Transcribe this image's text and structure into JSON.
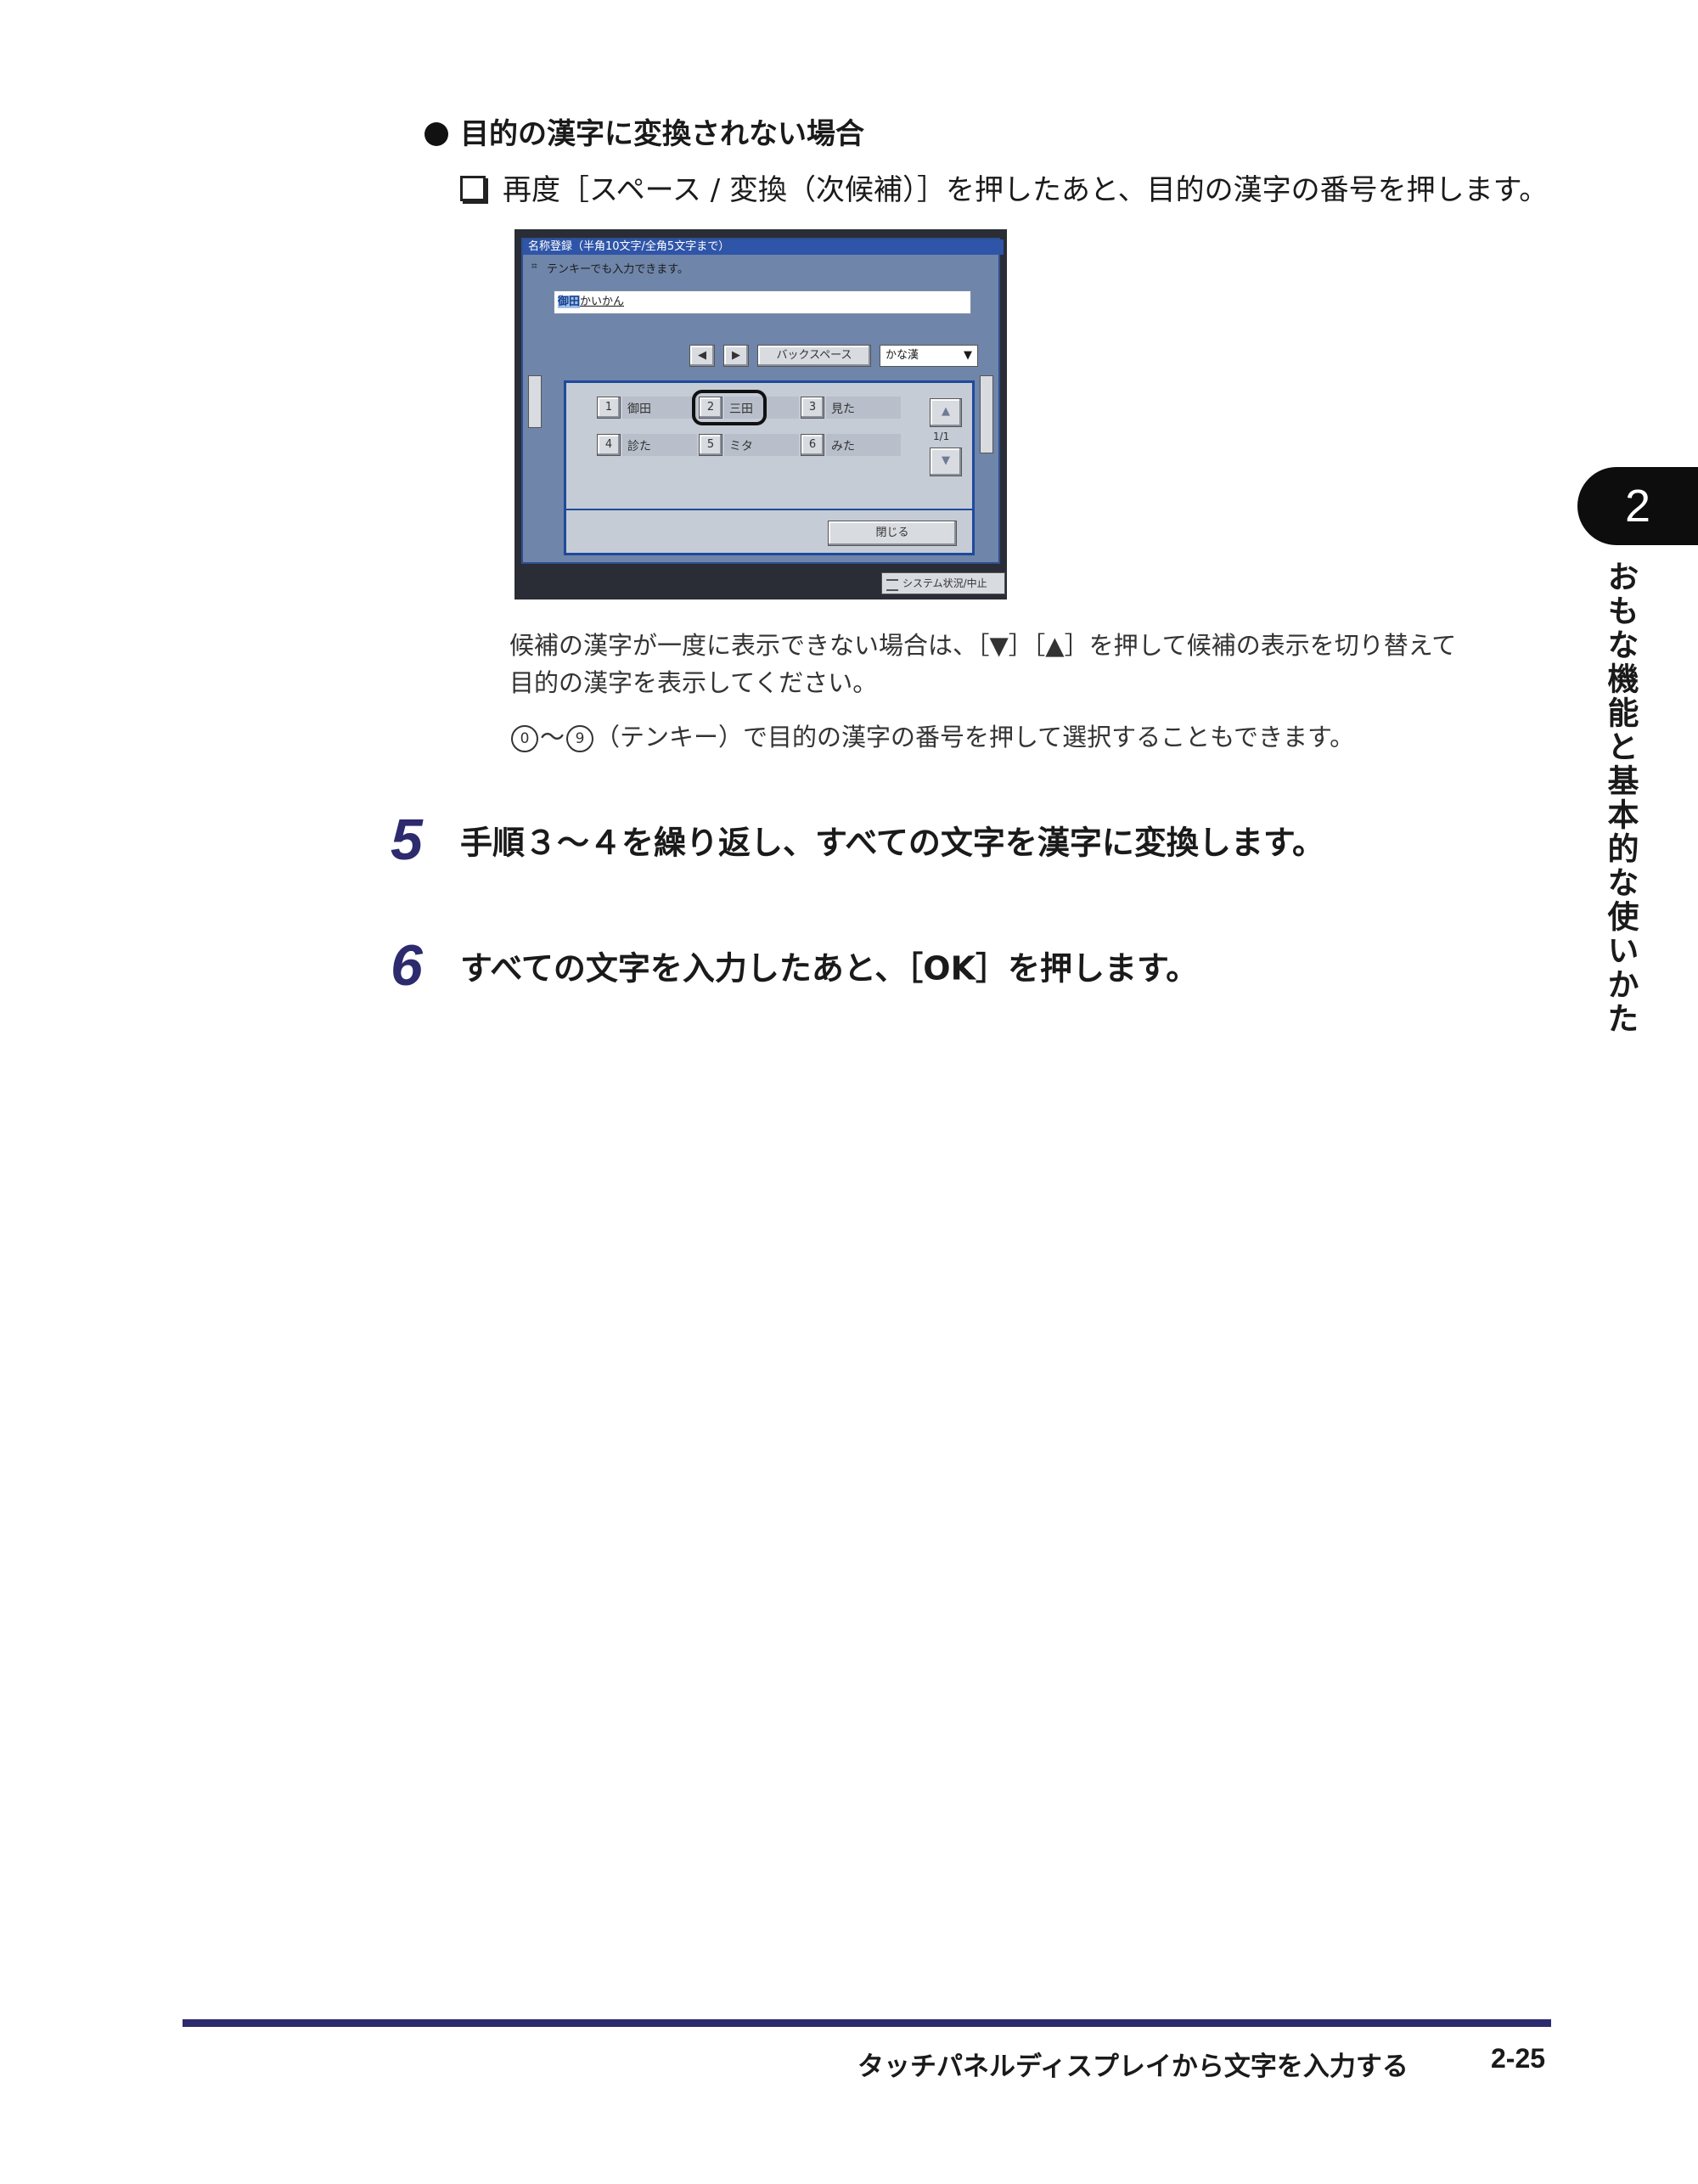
{
  "heading": {
    "text": "目的の漢字に変換されない場合"
  },
  "substep": {
    "text": "再度［スペース / 変換（次候補）］を押したあと、目的の漢字の番号を押します。"
  },
  "screen": {
    "title": "名称登録（半角10文字/全角5文字まで）",
    "hint": "テンキーでも入力できます。",
    "input_highlight": "御田",
    "input_rest": "かいかん",
    "arrow_left": "◀",
    "arrow_right": "▶",
    "backspace": "バックスペース",
    "mode_select": "かな漢",
    "mode_caret": "▼",
    "candidates": [
      {
        "num": "1",
        "label": "御田"
      },
      {
        "num": "2",
        "label": "三田"
      },
      {
        "num": "3",
        "label": "見た"
      },
      {
        "num": "4",
        "label": "診た"
      },
      {
        "num": "5",
        "label": "ミタ"
      },
      {
        "num": "6",
        "label": "みた"
      }
    ],
    "selected_index": 1,
    "scroll_up": "▲",
    "scroll_down": "▼",
    "pager": "1/1",
    "close": "閉じる",
    "status": "システム状況/中止"
  },
  "notes": {
    "note1_line1": "候補の漢字が一度に表示できない場合は、［▼］［▲］を押して候補の表示を切り替えて",
    "note1_line2": "目的の漢字を表示してください。",
    "note2_key_start": "0",
    "note2_tilde": "～",
    "note2_key_end": "9",
    "note2_text": "（テンキー）で目的の漢字の番号を押して選択することもできます。"
  },
  "steps": [
    {
      "num": "5",
      "text": "手順３～４を繰り返し、すべての文字を漢字に変換します。"
    },
    {
      "num": "6",
      "text": "すべての文字を入力したあと、［OK］を押します。"
    }
  ],
  "chapter": {
    "number": "2",
    "title": "おもな機能と基本的な使いかた"
  },
  "footer": {
    "section": "タッチパネルディスプレイから文字を入力する",
    "page": "2-25"
  },
  "colors": {
    "accent": "#2d2a6e",
    "screen_title_bar": "#2f55a8",
    "screen_bg": "#6f85a9"
  }
}
